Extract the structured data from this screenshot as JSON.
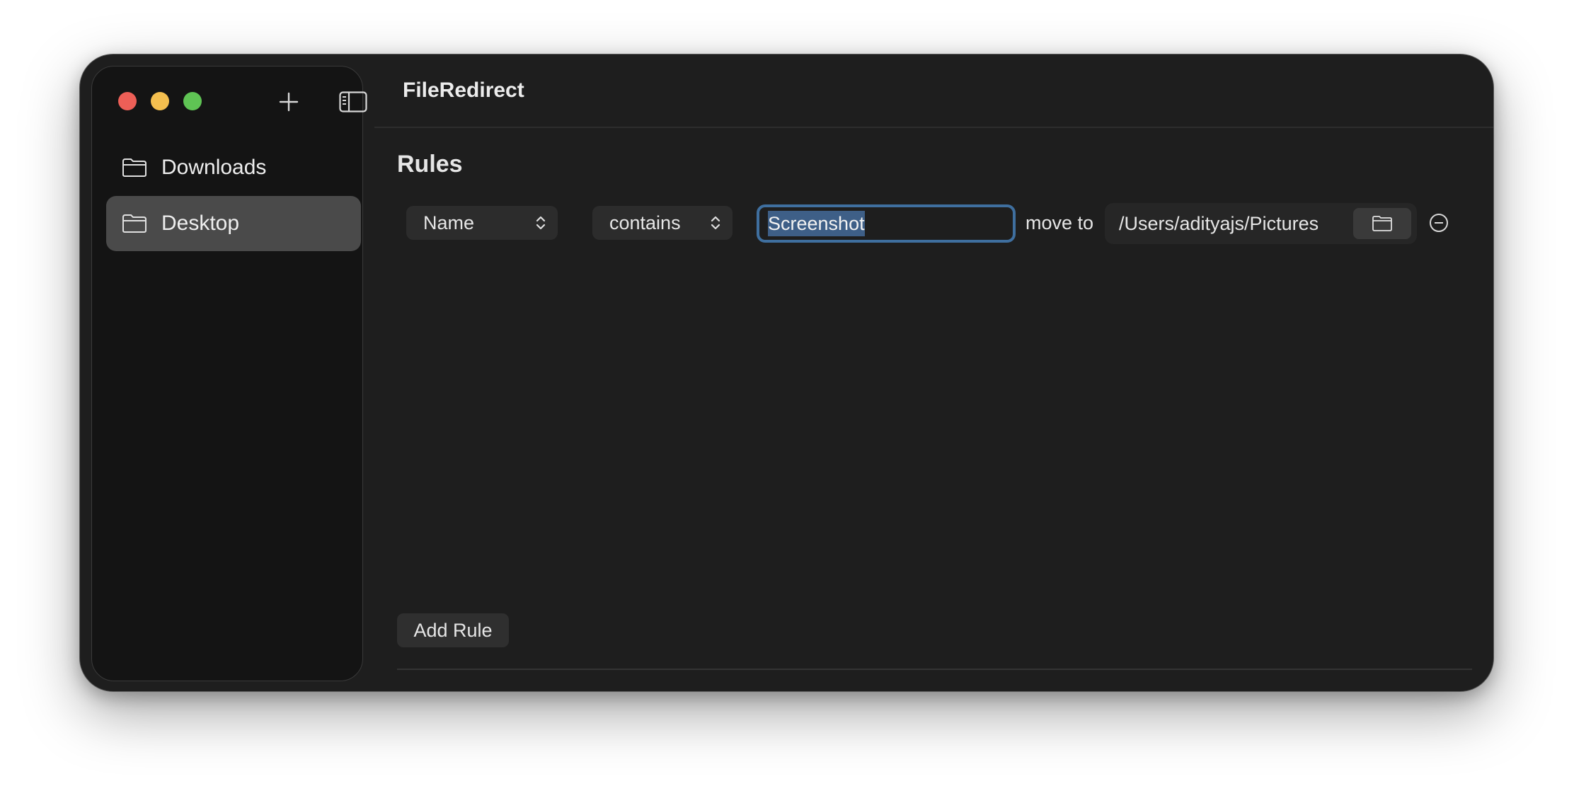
{
  "window": {
    "title": "FileRedirect"
  },
  "toolbar": {
    "add_icon": "plus-icon",
    "sidebar_toggle_icon": "sidebar-toggle-icon"
  },
  "sidebar": {
    "items": [
      {
        "label": "Downloads",
        "icon": "folder-icon",
        "selected": false
      },
      {
        "label": "Desktop",
        "icon": "folder-icon",
        "selected": true
      }
    ]
  },
  "main": {
    "heading": "Rules",
    "rules": [
      {
        "field": "Name",
        "operator": "contains",
        "value": "Screenshot",
        "action_label": "move to",
        "destination": "/Users/adityajs/Pictures"
      }
    ],
    "add_rule_label": "Add Rule"
  },
  "colors": {
    "window_bg": "#1e1e1e",
    "sidebar_bg": "#141414",
    "selection": "#4a4a4a",
    "focus_ring": "#3f6f9f",
    "text_selection": "#3e5f87",
    "close": "#ed5f57",
    "minimize": "#f4bf4f",
    "maximize": "#5fc454"
  }
}
